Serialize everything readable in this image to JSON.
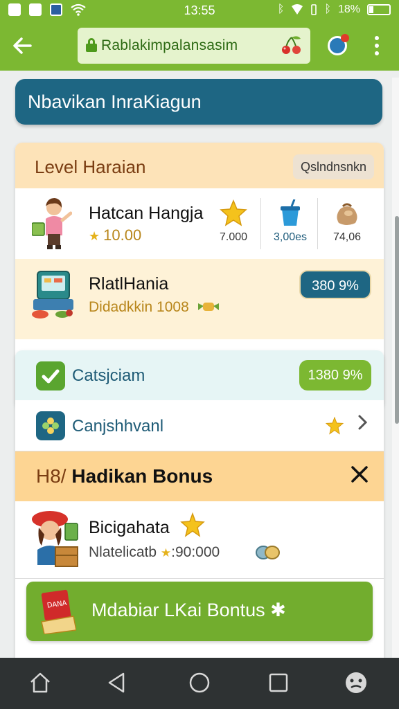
{
  "status_bar": {
    "time": "13:55",
    "battery": "18%"
  },
  "toolbar": {
    "url_text": "Rablakimpalansasim"
  },
  "header": {
    "title": "Nbavikan InraKiagun"
  },
  "level_section": {
    "title": "Level Haraian",
    "button_label": "Qslndnsnkn",
    "row1": {
      "name": "Hatcan Hangja",
      "points": "10.00",
      "stats": [
        {
          "icon": "star-icon",
          "value": "7.000"
        },
        {
          "icon": "cup-icon",
          "value": "3,00es"
        },
        {
          "icon": "coin-bag-icon",
          "value": "74,06"
        }
      ]
    },
    "row2": {
      "name": "RlatlHania",
      "subtitle": "Didadkkin 1008",
      "pill": "380 9%"
    }
  },
  "list": {
    "item_a": {
      "label": "Catsjciam",
      "pill": "1380 9%"
    },
    "item_b": {
      "label": "Canjshhvanl"
    },
    "bonus": {
      "title_prefix": "H8/",
      "title": "Hadikan Bonus",
      "item_name": "Bicigahata",
      "item_sub": "Nlatelicatb",
      "item_value": ":90:000"
    },
    "claim_button": {
      "label": "Mdabiar LKai Bontus",
      "badge_text": "DANA"
    }
  },
  "colors": {
    "accent_green": "#7cb832",
    "teal": "#1e6683",
    "gold": "#b8861b",
    "orange_header": "#fdd593"
  }
}
